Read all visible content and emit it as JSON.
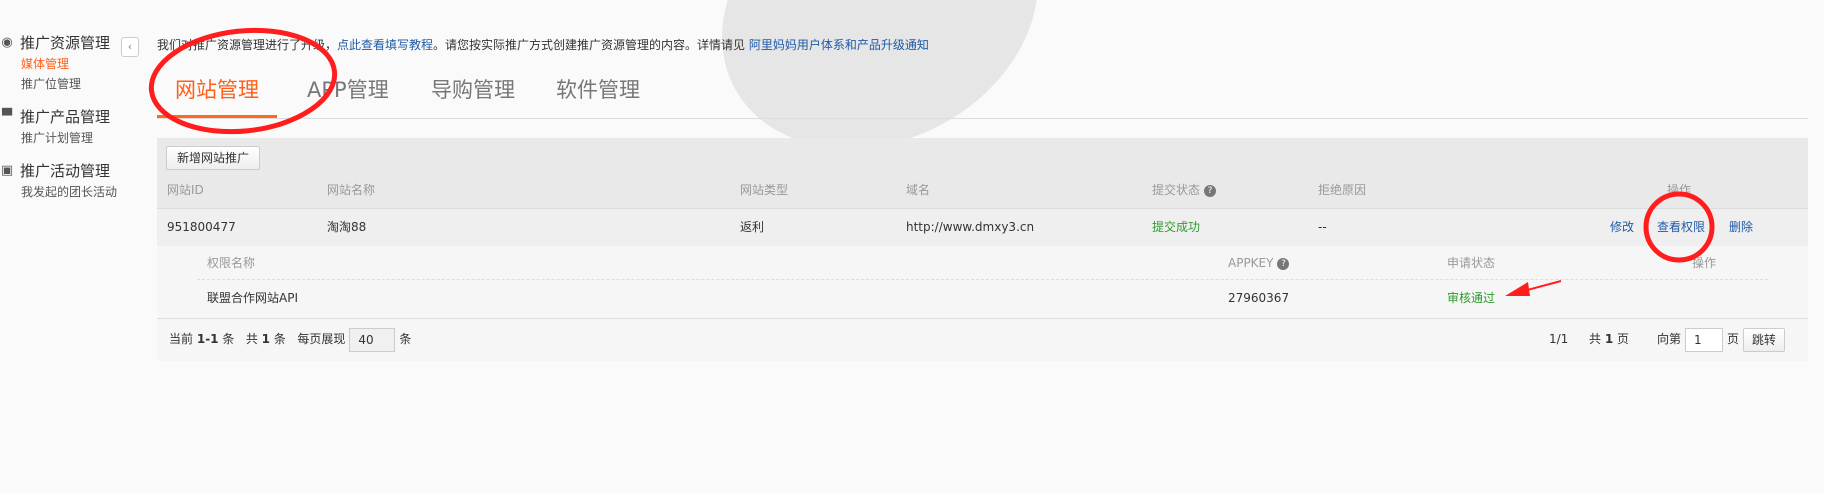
{
  "sidebar": {
    "collapse_label": "‹",
    "groups": [
      {
        "label": "推广资源管理",
        "icon": "globe-icon",
        "items": [
          "媒体管理",
          "推广位管理"
        ]
      },
      {
        "label": "推广产品管理",
        "icon": "pin-icon",
        "items": [
          "推广计划管理"
        ]
      },
      {
        "label": "推广活动管理",
        "icon": "activity-icon",
        "items": [
          "我发起的团长活动"
        ]
      }
    ]
  },
  "notice": {
    "prefix": "我们对推广资源管理进行了升级，",
    "link1": "点此查看填写教程",
    "middle": "。请您按实际推广方式创建推广资源管理的内容。详情请见",
    "link2": "阿里妈妈用户体系和产品升级通知"
  },
  "tabs": [
    "网站管理",
    "APP管理",
    "导购管理",
    "软件管理"
  ],
  "toolbar": {
    "add_label": "新增网站推广"
  },
  "table": {
    "headers": [
      "网站ID",
      "网站名称",
      "网站类型",
      "域名",
      "提交状态",
      "拒绝原因",
      "操作"
    ],
    "help_glyph": "?",
    "row": {
      "id": "951800477",
      "name": "淘淘88",
      "type": "返利",
      "domain": "http://www.dmxy3.cn",
      "status": "提交成功",
      "reason": "--",
      "actions": [
        "修改",
        "查看权限",
        "删除"
      ]
    }
  },
  "permissions": {
    "headers": [
      "权限名称",
      "APPKEY",
      "申请状态",
      "操作"
    ],
    "row": {
      "name": "联盟合作网站API",
      "appkey": "27960367",
      "status": "审核通过"
    }
  },
  "pager": {
    "current_prefix": "当前",
    "current_range": "1-1",
    "current_suffix": "条",
    "total_prefix": "共",
    "total": "1",
    "total_suffix": "条",
    "per_page_label": "每页展现",
    "per_page": "40",
    "per_page_suffix": "条",
    "page_info": "1/1",
    "pages_prefix": "共",
    "pages_total": "1",
    "pages_suffix": "页",
    "goto_label": "向第",
    "goto_value": "1",
    "goto_suffix": "页",
    "jump_label": "跳转"
  },
  "colors": {
    "accent": "#ff5f18",
    "link": "#1f5aa8",
    "success": "#2f9a2f",
    "annotation": "#ff1d1d"
  }
}
